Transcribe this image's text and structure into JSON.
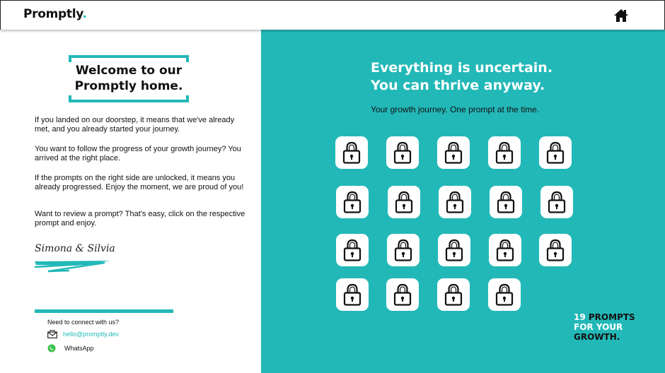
{
  "header": {
    "logo_text": "Promptly",
    "logo_dot": ".",
    "home_icon": "home-icon"
  },
  "welcome": {
    "title_line1": "Welcome to our",
    "title_line2": "Promptly home."
  },
  "intro": {
    "p1": "If you landed on our doorstep, it means that we've already met, and you already started your journey.",
    "p2": "You want to follow the progress of your growth journey? You arrived at the right place.",
    "p3": "If the prompts on the right side are unlocked, it means you already progressed. Enjoy the moment, we are proud of you!",
    "p4": "Want to review a prompt? That's easy, click on the respective prompt and enjoy."
  },
  "signature": "Simona & Silvia",
  "contact": {
    "title": "Need to connect with us?",
    "email": "hello@promptly.dev",
    "email_icon": "envelope-icon",
    "whatsapp": "WhatsApp",
    "whatsapp_icon": "whatsapp-icon"
  },
  "hero": {
    "headline_line1": "Everything is uncertain.",
    "headline_line2": "You can thrive anyway.",
    "subline": "Your growth journey. One prompt at the time."
  },
  "prompts": {
    "count": 19,
    "state": "locked",
    "icon": "lock-icon"
  },
  "tagline": {
    "number": "19",
    "word1": "PROMPTS",
    "line2": "FOR YOUR",
    "line3": "GROWTH."
  },
  "colors": {
    "accent": "#23b8b8",
    "text": "#111111",
    "white": "#ffffff"
  }
}
